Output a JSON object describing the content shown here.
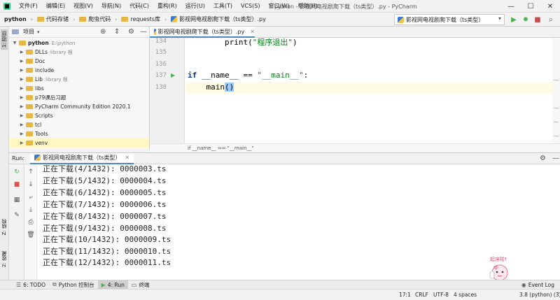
{
  "menubar": {
    "items": [
      "文件(F)",
      "编辑(E)",
      "视图(V)",
      "导航(N)",
      "代码(C)",
      "重构(R)",
      "运行(U)",
      "工具(T)",
      "VCS(S)",
      "窗口(W)",
      "帮助(H)"
    ],
    "window_title": "python - 影视网电视剧爬下载（ts类型）.py - PyCharm",
    "controls": [
      "—",
      "☐",
      "✕"
    ]
  },
  "navbar": {
    "breadcrumbs": [
      "python",
      "代码存储",
      "爬虫代码",
      "requests库",
      "影视网电视剧爬下载（ts类型）.py"
    ],
    "run_config": "影视网电视剧爬下载（ts类型）"
  },
  "left_strip": {
    "project": "1: 项目",
    "structure": "Z: 结构",
    "favorites": "2: 收藏"
  },
  "project_panel": {
    "title": "项目",
    "tree": [
      {
        "label": "python",
        "hint": "E:\\python",
        "expanded": true,
        "bold": true,
        "indent": 0
      },
      {
        "label": "DLLs",
        "hint": "library 根",
        "indent": 1
      },
      {
        "label": "Doc",
        "hint": "",
        "indent": 1
      },
      {
        "label": "include",
        "hint": "",
        "indent": 1
      },
      {
        "label": "Lib",
        "hint": "library 根",
        "indent": 1
      },
      {
        "label": "libs",
        "hint": "",
        "indent": 1
      },
      {
        "label": "p79课后习题",
        "hint": "",
        "indent": 1
      },
      {
        "label": "PyCharm Community Edition 2020.1",
        "hint": "",
        "indent": 1
      },
      {
        "label": "Scripts",
        "hint": "",
        "indent": 1
      },
      {
        "label": "tcl",
        "hint": "",
        "indent": 1
      },
      {
        "label": "Tools",
        "hint": "",
        "indent": 1
      },
      {
        "label": "venv",
        "hint": "",
        "indent": 1,
        "selected": true
      }
    ]
  },
  "editor": {
    "tab": "影视网电视剧爬下载（ts类型）.py",
    "line_numbers": [
      "134",
      "135",
      "136",
      "137",
      "138"
    ],
    "line134": {
      "indent": "        ",
      "func": "print",
      "open": "(",
      "str": "\"程序退出\"",
      "close": ")"
    },
    "line137": {
      "kw": "if",
      "mid": " __name__ == ",
      "str": "\"__main__\"",
      "end": ":"
    },
    "line138": {
      "indent": "    ",
      "call": "main",
      "paren": "()"
    },
    "breadcrumb": "if __name__ == \"__main__\""
  },
  "run_panel": {
    "label": "Run:",
    "tab": "影视网电视剧爬下载（ts类型）",
    "console": [
      "正在下载(4/1432): 0000003.ts",
      "正在下载(5/1432): 0000004.ts",
      "正在下载(6/1432): 0000005.ts",
      "正在下载(7/1432): 0000006.ts",
      "正在下载(8/1432): 0000007.ts",
      "正在下载(9/1432): 0000008.ts",
      "正在下载(10/1432): 0000009.ts",
      "正在下载(11/1432): 0000010.ts",
      "正在下载(12/1432): 0000011.ts"
    ]
  },
  "bottom_bar": {
    "todo": "6: TODO",
    "python_console": "Python 控制台",
    "run": "4: Run",
    "terminal": "终端",
    "event_log": "Event Log"
  },
  "mascot": {
    "text_top": "起床啦!",
    "text_mid": "中"
  },
  "statusbar": {
    "position": "17:1",
    "line_sep": "CRLF",
    "encoding": "UTF-8",
    "indent": "4 spaces",
    "interpreter": "3.8 (python) (3)"
  },
  "colors": {
    "accent": "#4a88c7",
    "keyword": "#0033b3",
    "string": "#067d17",
    "folder": "#e8b743"
  }
}
